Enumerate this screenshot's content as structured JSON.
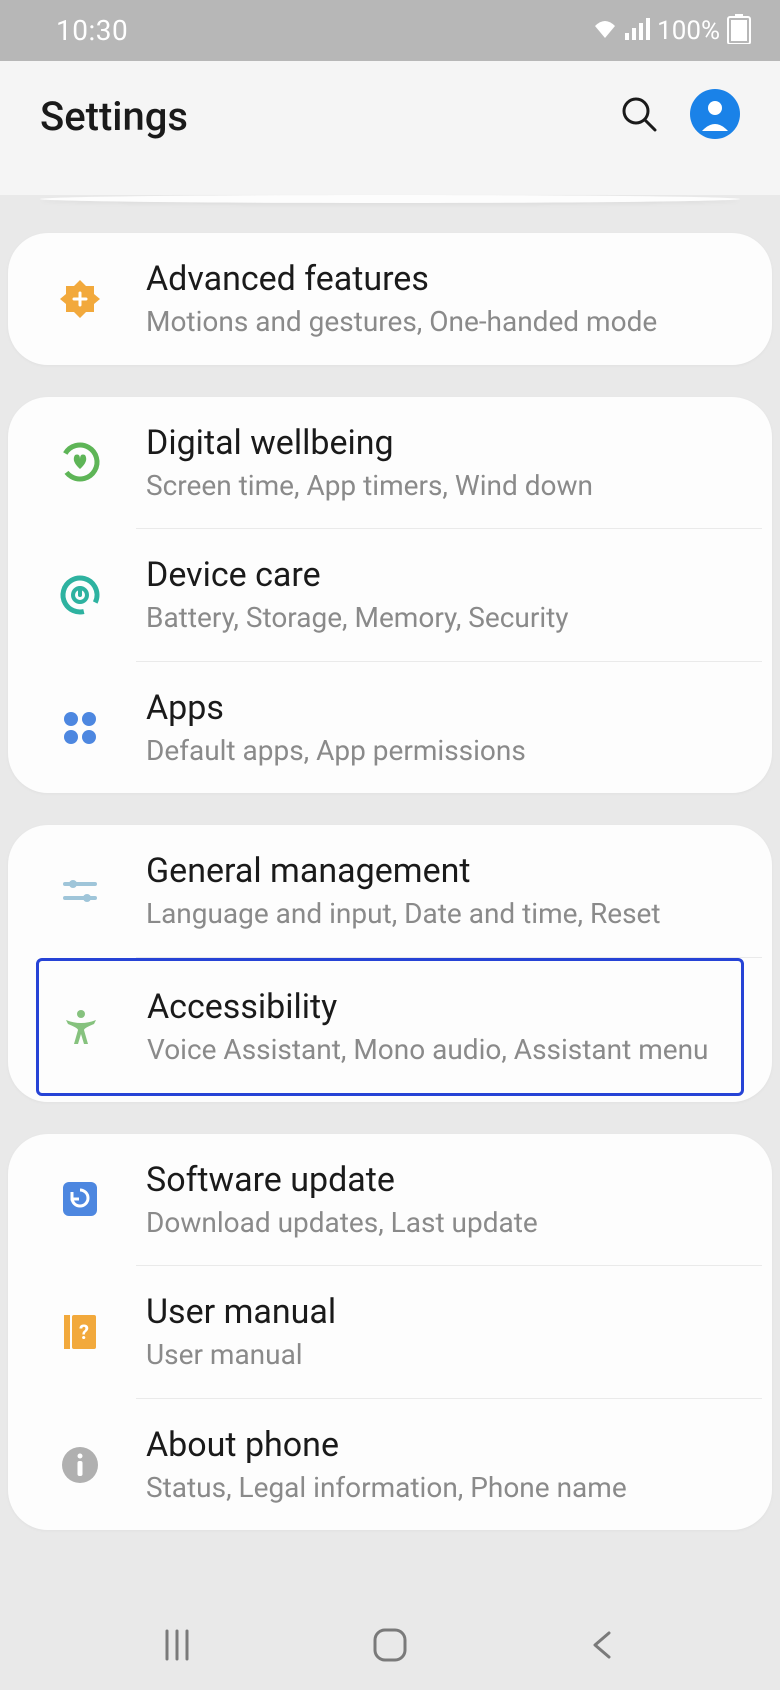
{
  "status": {
    "time": "10:30",
    "battery": "100%"
  },
  "header": {
    "title": "Settings"
  },
  "groups": [
    {
      "items": [
        {
          "key": "advanced",
          "title": "Advanced features",
          "subtitle": "Motions and gestures, One-handed mode"
        }
      ]
    },
    {
      "items": [
        {
          "key": "wellbeing",
          "title": "Digital wellbeing",
          "subtitle": "Screen time, App timers, Wind down"
        },
        {
          "key": "devicecare",
          "title": "Device care",
          "subtitle": "Battery, Storage, Memory, Security"
        },
        {
          "key": "apps",
          "title": "Apps",
          "subtitle": "Default apps, App permissions"
        }
      ]
    },
    {
      "items": [
        {
          "key": "general",
          "title": "General management",
          "subtitle": "Language and input, Date and time, Reset"
        },
        {
          "key": "accessibility",
          "title": "Accessibility",
          "subtitle": "Voice Assistant, Mono audio, Assistant menu",
          "highlighted": true
        }
      ]
    },
    {
      "items": [
        {
          "key": "update",
          "title": "Software update",
          "subtitle": "Download updates, Last update"
        },
        {
          "key": "manual",
          "title": "User manual",
          "subtitle": "User manual"
        },
        {
          "key": "about",
          "title": "About phone",
          "subtitle": "Status, Legal information, Phone name"
        }
      ]
    }
  ]
}
